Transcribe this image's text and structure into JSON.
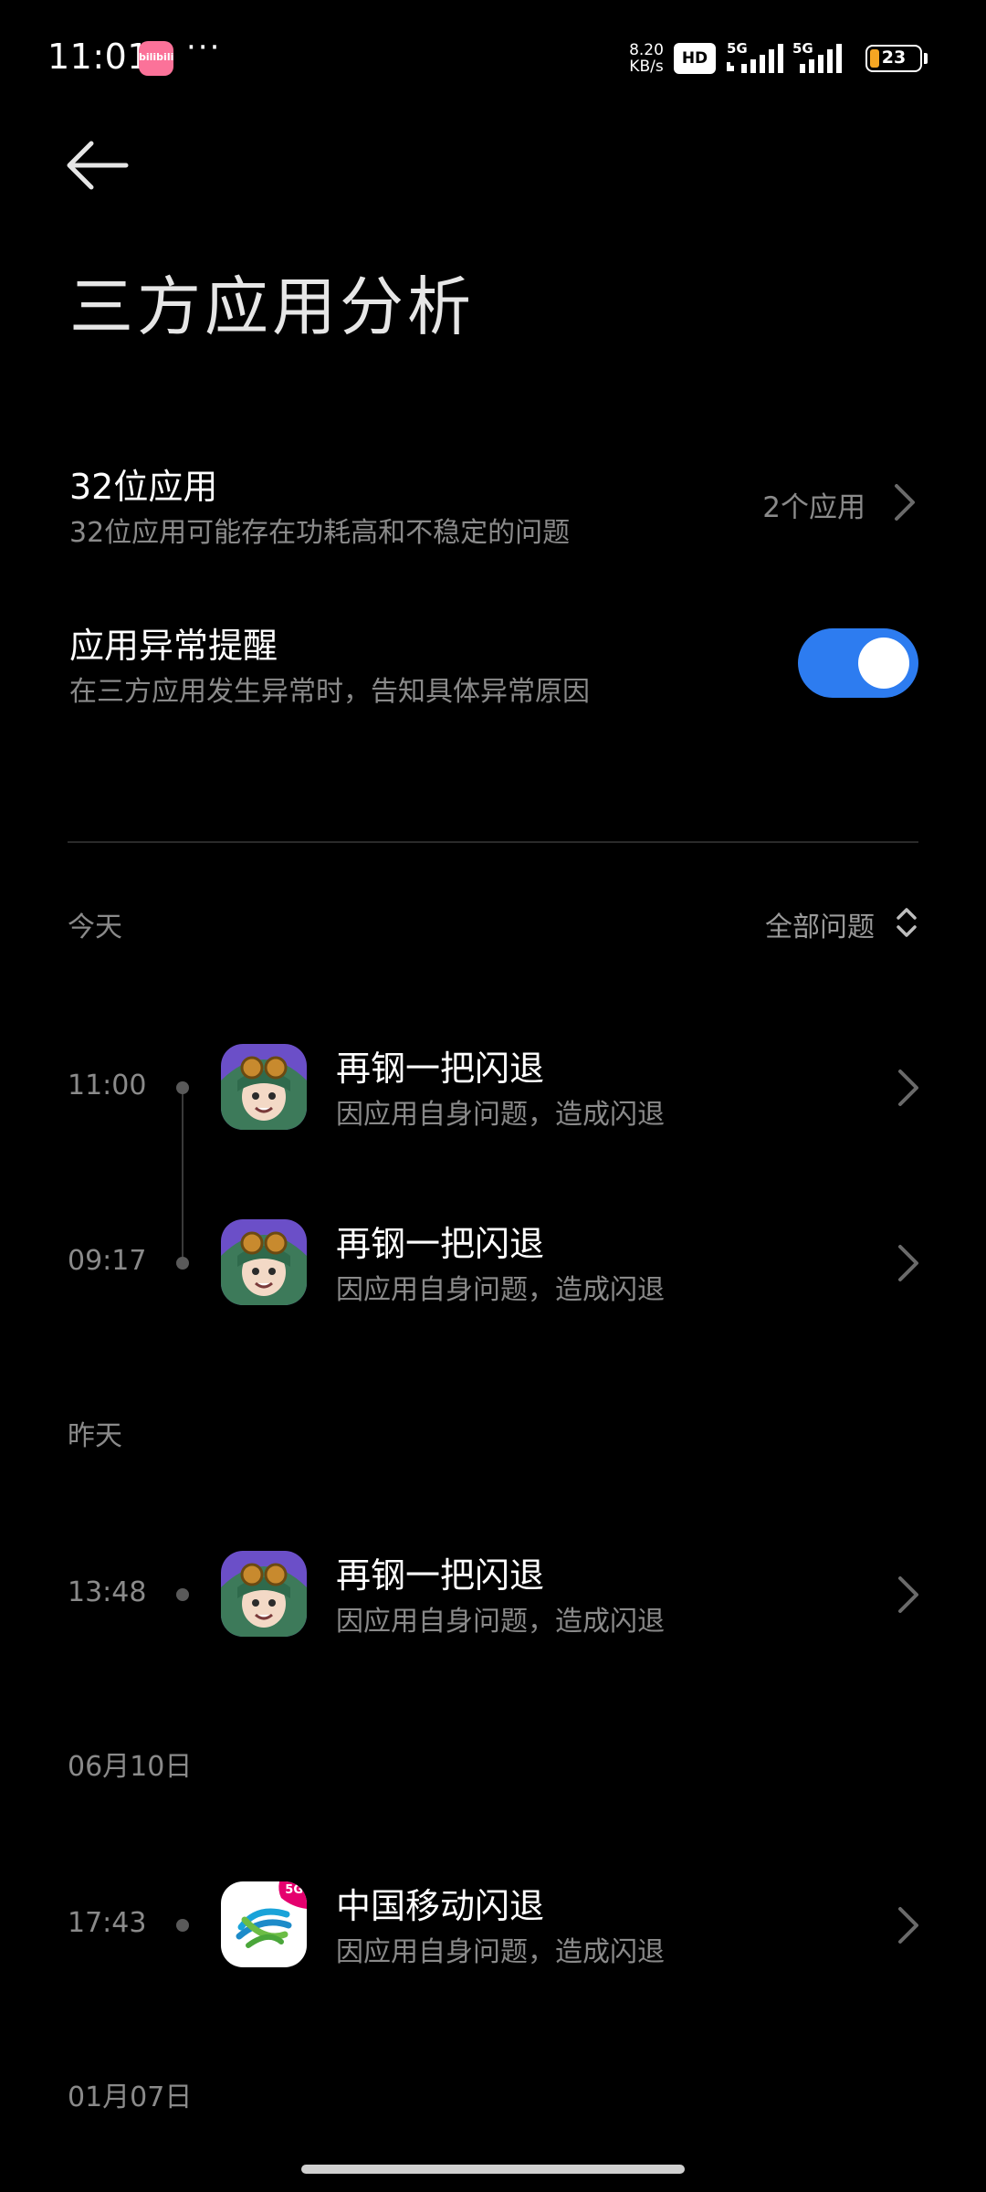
{
  "status_bar": {
    "time": "11:01",
    "app_badge": "bilibili",
    "more": "···",
    "net_speed_value": "8.20",
    "net_speed_unit": "KB/s",
    "hd_label": "HD",
    "sim1_label": "5G",
    "sim2_label": "5G",
    "battery_level": "23",
    "battery_color": "#f5a623"
  },
  "header": {
    "back_icon": "arrow-left-icon",
    "title": "三方应用分析"
  },
  "settings": {
    "bit32": {
      "title": "32位应用",
      "description": "32位应用可能存在功耗高和不稳定的问题",
      "value": "2个应用"
    },
    "anomaly_alert": {
      "title": "应用异常提醒",
      "description": "在三方应用发生异常时，告知具体异常原因",
      "enabled": true,
      "toggle_color": "#2d7cf0"
    }
  },
  "filter": {
    "label": "全部问题"
  },
  "sections": [
    {
      "date": "今天",
      "events": [
        {
          "time": "11:00",
          "app_icon": "game-character-icon",
          "title": "再钢一把闪退",
          "description": "因应用自身问题，造成闪退"
        },
        {
          "time": "09:17",
          "app_icon": "game-character-icon",
          "title": "再钢一把闪退",
          "description": "因应用自身问题，造成闪退"
        }
      ]
    },
    {
      "date": "昨天",
      "events": [
        {
          "time": "13:48",
          "app_icon": "game-character-icon",
          "title": "再钢一把闪退",
          "description": "因应用自身问题，造成闪退"
        }
      ]
    },
    {
      "date": "06月10日",
      "events": [
        {
          "time": "17:43",
          "app_icon": "china-mobile-icon",
          "title": "中国移动闪退",
          "description": "因应用自身问题，造成闪退",
          "badge": "5G"
        }
      ]
    },
    {
      "date": "01月07日",
      "events": []
    }
  ]
}
